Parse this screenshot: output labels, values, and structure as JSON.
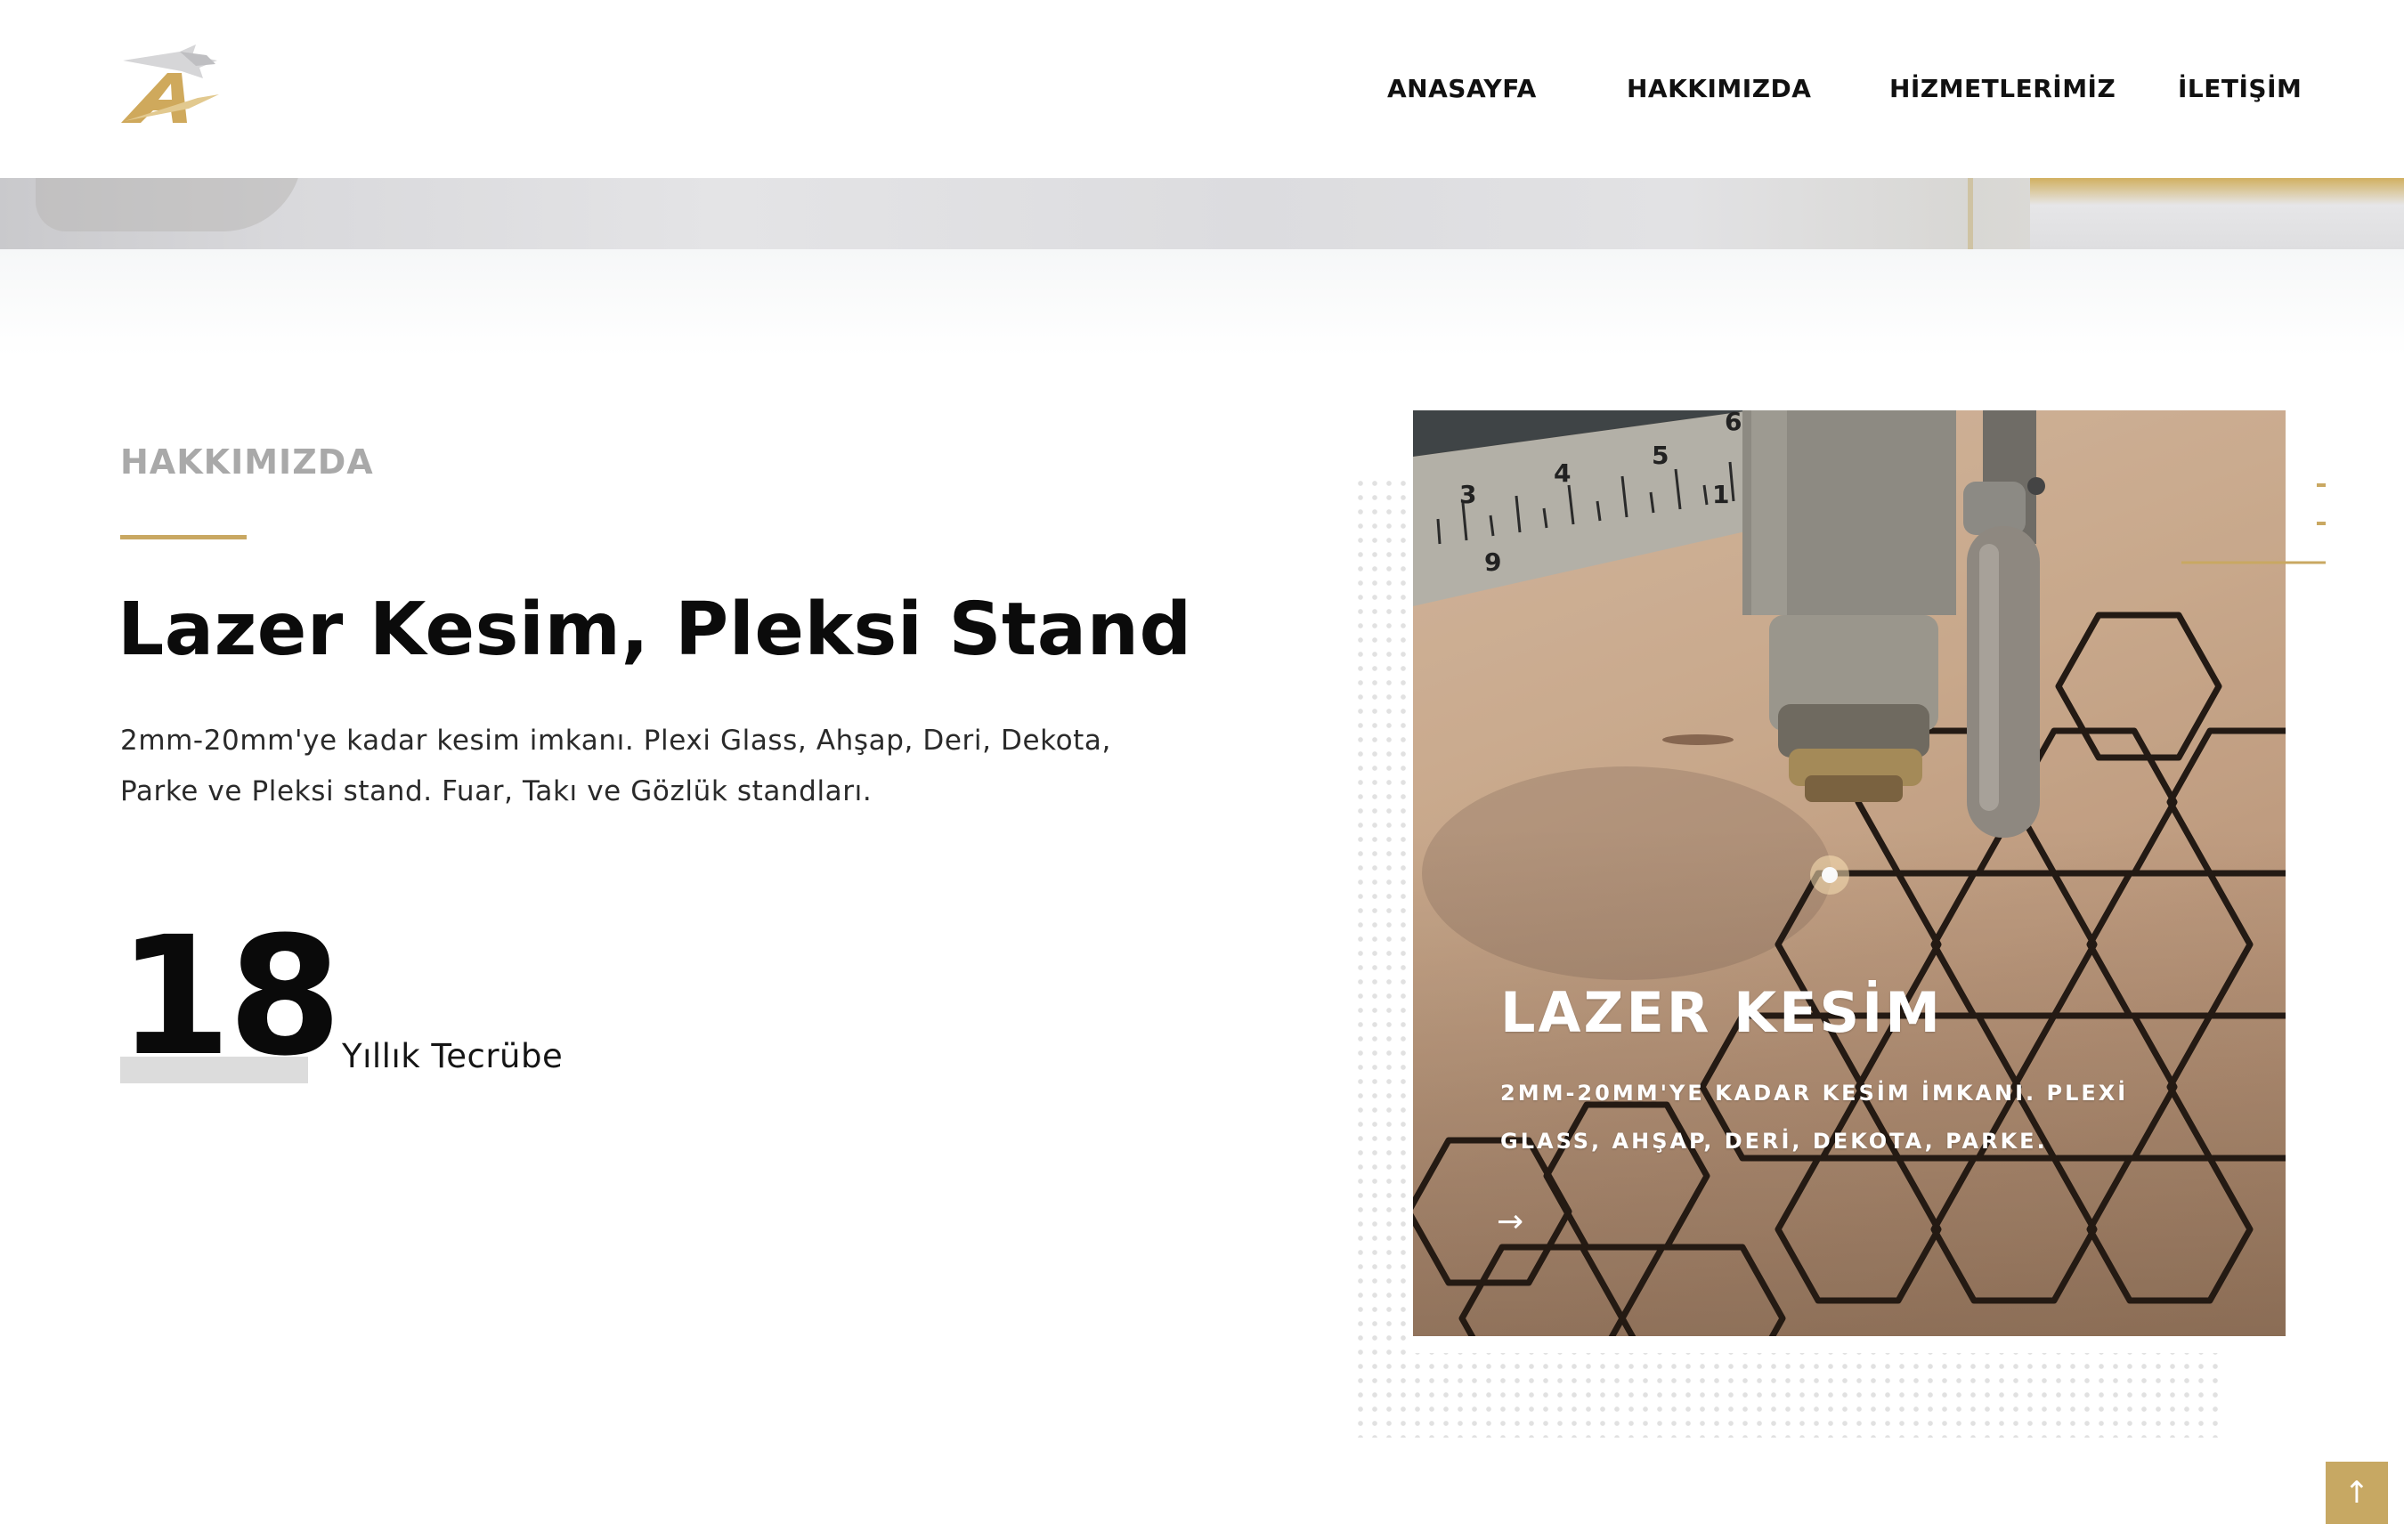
{
  "header": {
    "logo_icon": "eagle-letter-a-logo",
    "nav": [
      "ANASAYFA",
      "HAKKIMIZDA",
      "HİZMETLERİMİZ",
      "İLETİŞİM"
    ]
  },
  "about": {
    "eyebrow": "HAKKIMIZDA",
    "title": "Lazer Kesim, Pleksi Stand",
    "description": "2mm-20mm'ye kadar kesim imkanı. Plexi Glass, Ahşap, Deri, Dekota, Parke ve Pleksi stand. Fuar, Takı ve Gözlük standları.",
    "stat_number": "18",
    "stat_label": "Yıllık Tecrübe"
  },
  "card": {
    "title": "LAZER KESİM",
    "text": "2MM-20MM'YE KADAR KESİM İMKANI. PLEXİ GLASS, AHŞAP, DERİ, DEKOTA, PARKE.",
    "arrow": "→",
    "ruler_ticks": [
      "3",
      "4",
      "5",
      "6",
      "9",
      "1"
    ]
  },
  "scroll_top": {
    "icon": "arrow-up-icon",
    "glyph": "↑"
  },
  "colors": {
    "accent_gold": "#c9a862",
    "text_dark": "#0b0b0b",
    "eyebrow_gray": "#a9a9a9"
  }
}
